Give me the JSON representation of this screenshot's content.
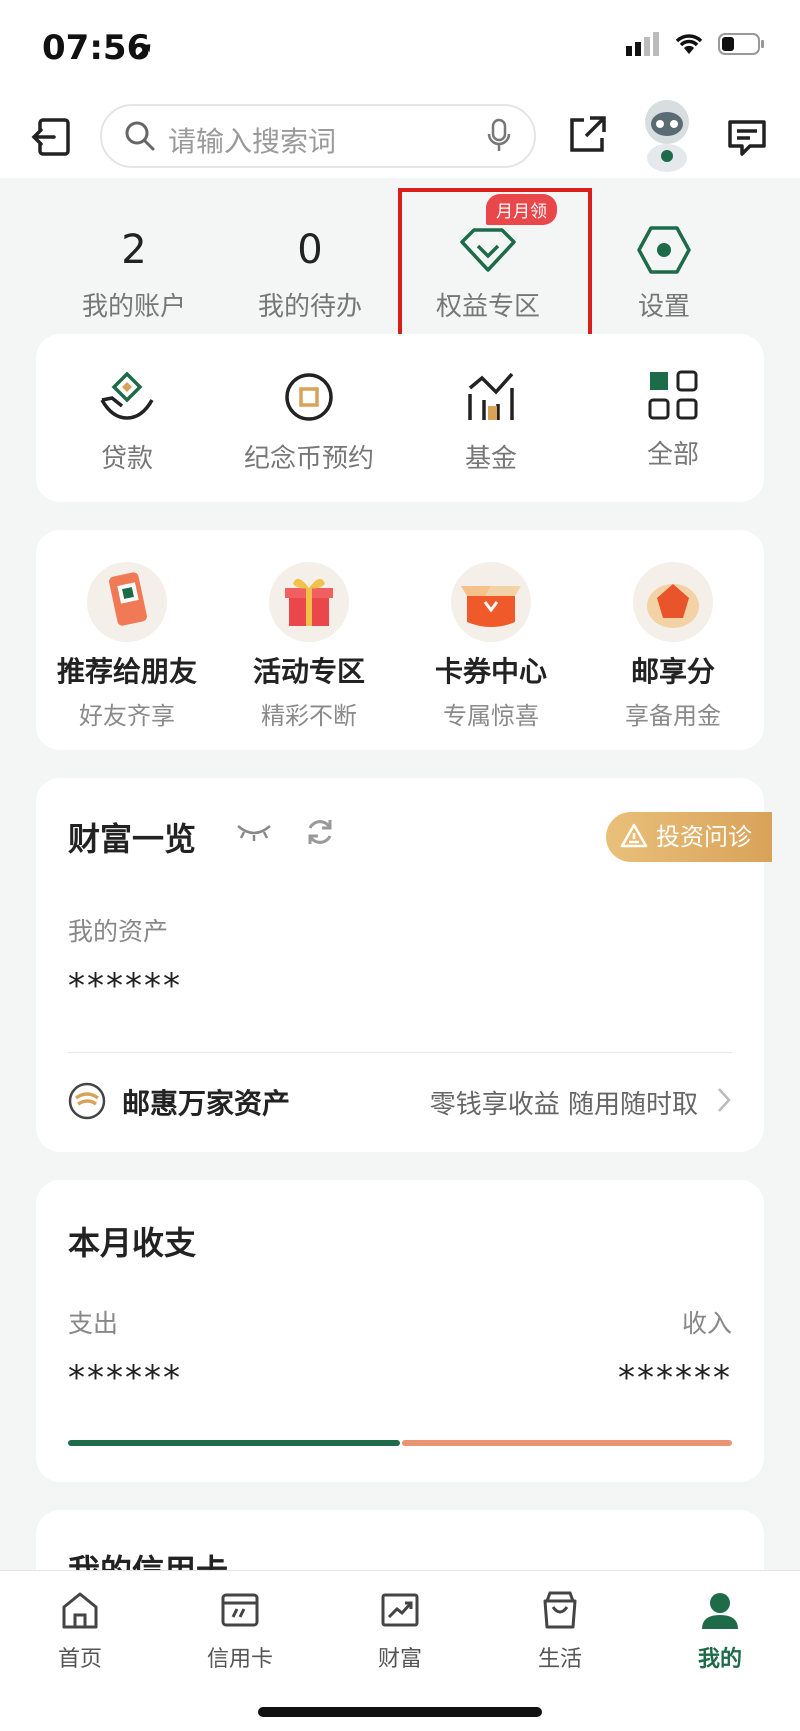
{
  "status": {
    "time": "07:56"
  },
  "search": {
    "placeholder": "请输入搜索词"
  },
  "stats": [
    {
      "value": "2",
      "label": "我的账户"
    },
    {
      "value": "0",
      "label": "我的待办"
    },
    {
      "label": "权益专区",
      "badge": "月月领"
    },
    {
      "label": "设置"
    }
  ],
  "menu": [
    {
      "label": "贷款",
      "icon": "loan-icon"
    },
    {
      "label": "纪念币预约",
      "icon": "coin-icon"
    },
    {
      "label": "基金",
      "icon": "fund-icon"
    },
    {
      "label": "全部",
      "icon": "grid-icon"
    }
  ],
  "promo": [
    {
      "title": "推荐给朋友",
      "sub": "好友齐享"
    },
    {
      "title": "活动专区",
      "sub": "精彩不断"
    },
    {
      "title": "卡券中心",
      "sub": "专属惊喜"
    },
    {
      "title": "邮享分",
      "sub": "享备用金"
    }
  ],
  "wealth": {
    "title": "财富一览",
    "invest_label": "投资问诊",
    "asset_label": "我的资产",
    "asset_value": "******",
    "product_name": "邮惠万家资产",
    "product_desc": "零钱享收益 随用随时取"
  },
  "monthly": {
    "title": "本月收支",
    "out_label": "支出",
    "in_label": "收入",
    "out_value": "******",
    "in_value": "******"
  },
  "credit": {
    "title": "我的信用卡"
  },
  "tabs": [
    {
      "label": "首页"
    },
    {
      "label": "信用卡"
    },
    {
      "label": "财富"
    },
    {
      "label": "生活"
    },
    {
      "label": "我的"
    }
  ],
  "colors": {
    "brand_green": "#1e6b4a",
    "highlight_red": "#d91e1e",
    "badge_red": "#e9474a",
    "gold": "#d9a259",
    "income_orange": "#e99574"
  }
}
